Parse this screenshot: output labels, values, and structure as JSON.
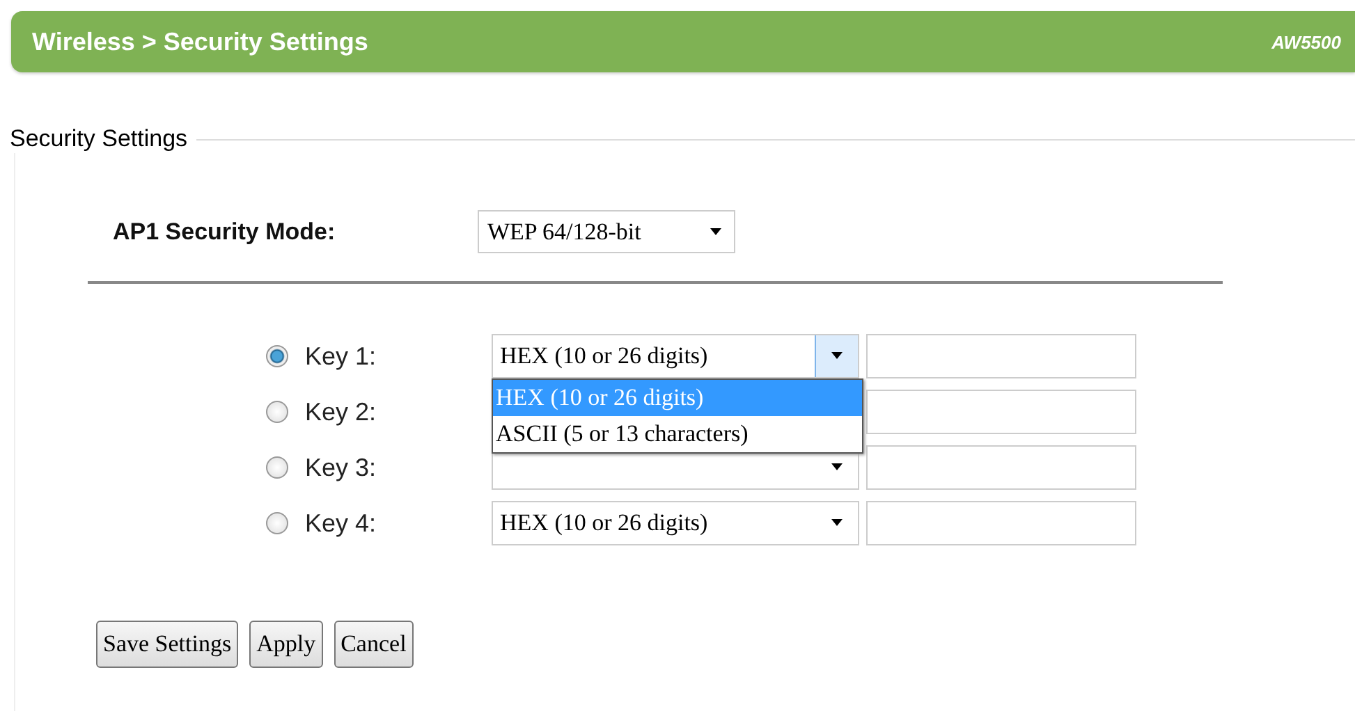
{
  "header": {
    "title": "Wireless > Security Settings",
    "model": "AW5500"
  },
  "section": {
    "legend": "Security Settings"
  },
  "security_mode": {
    "label": "AP1 Security Mode:",
    "value": "WEP 64/128-bit"
  },
  "keys": [
    {
      "label": "Key 1:",
      "selected": true,
      "format": "HEX (10 or 26 digits)",
      "expanded": true
    },
    {
      "label": "Key 2:",
      "selected": false,
      "expanded": false
    },
    {
      "label": "Key 3:",
      "selected": false,
      "expanded": false
    },
    {
      "label": "Key 4:",
      "selected": false,
      "format": "HEX (10 or 26 digits)",
      "expanded": false
    }
  ],
  "dropdown_options": [
    {
      "label": "HEX (10 or 26 digits)",
      "selected": true
    },
    {
      "label": "ASCII (5 or 13 characters)",
      "selected": false
    }
  ],
  "buttons": [
    "Save Settings",
    "Apply",
    "Cancel"
  ]
}
